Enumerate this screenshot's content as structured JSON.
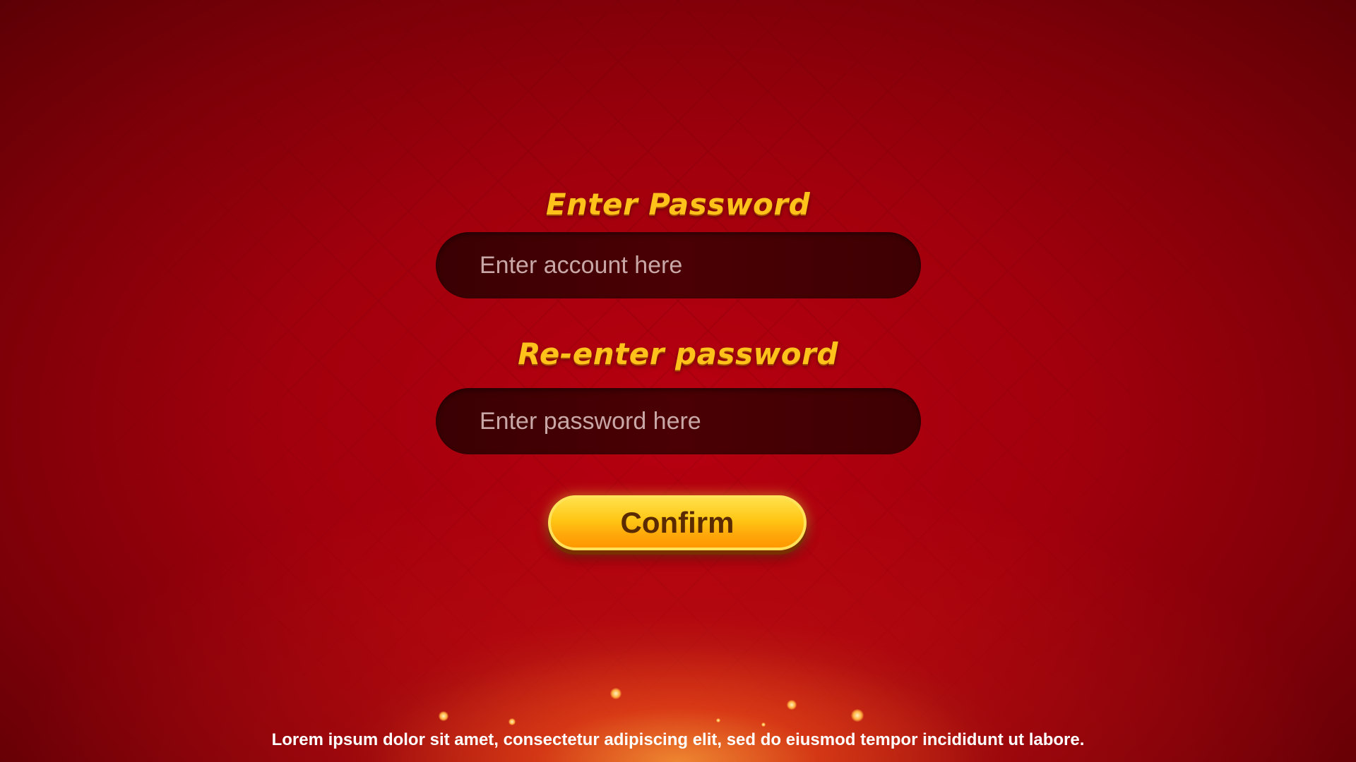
{
  "form": {
    "password_heading": "Enter Password",
    "account_placeholder": "Enter account here",
    "reenter_heading": "Re-enter password",
    "password_placeholder": "Enter password here",
    "confirm_label": "Confirm"
  },
  "footer": {
    "text": "Lorem ipsum dolor sit amet, consectetur adipiscing elit, sed do eiusmod tempor incididunt ut labore."
  },
  "colors": {
    "background": "#a0000c",
    "heading": "#ffc21a",
    "field": "#4a0004",
    "button": "#ffc615",
    "button_text": "#5a2a00"
  }
}
